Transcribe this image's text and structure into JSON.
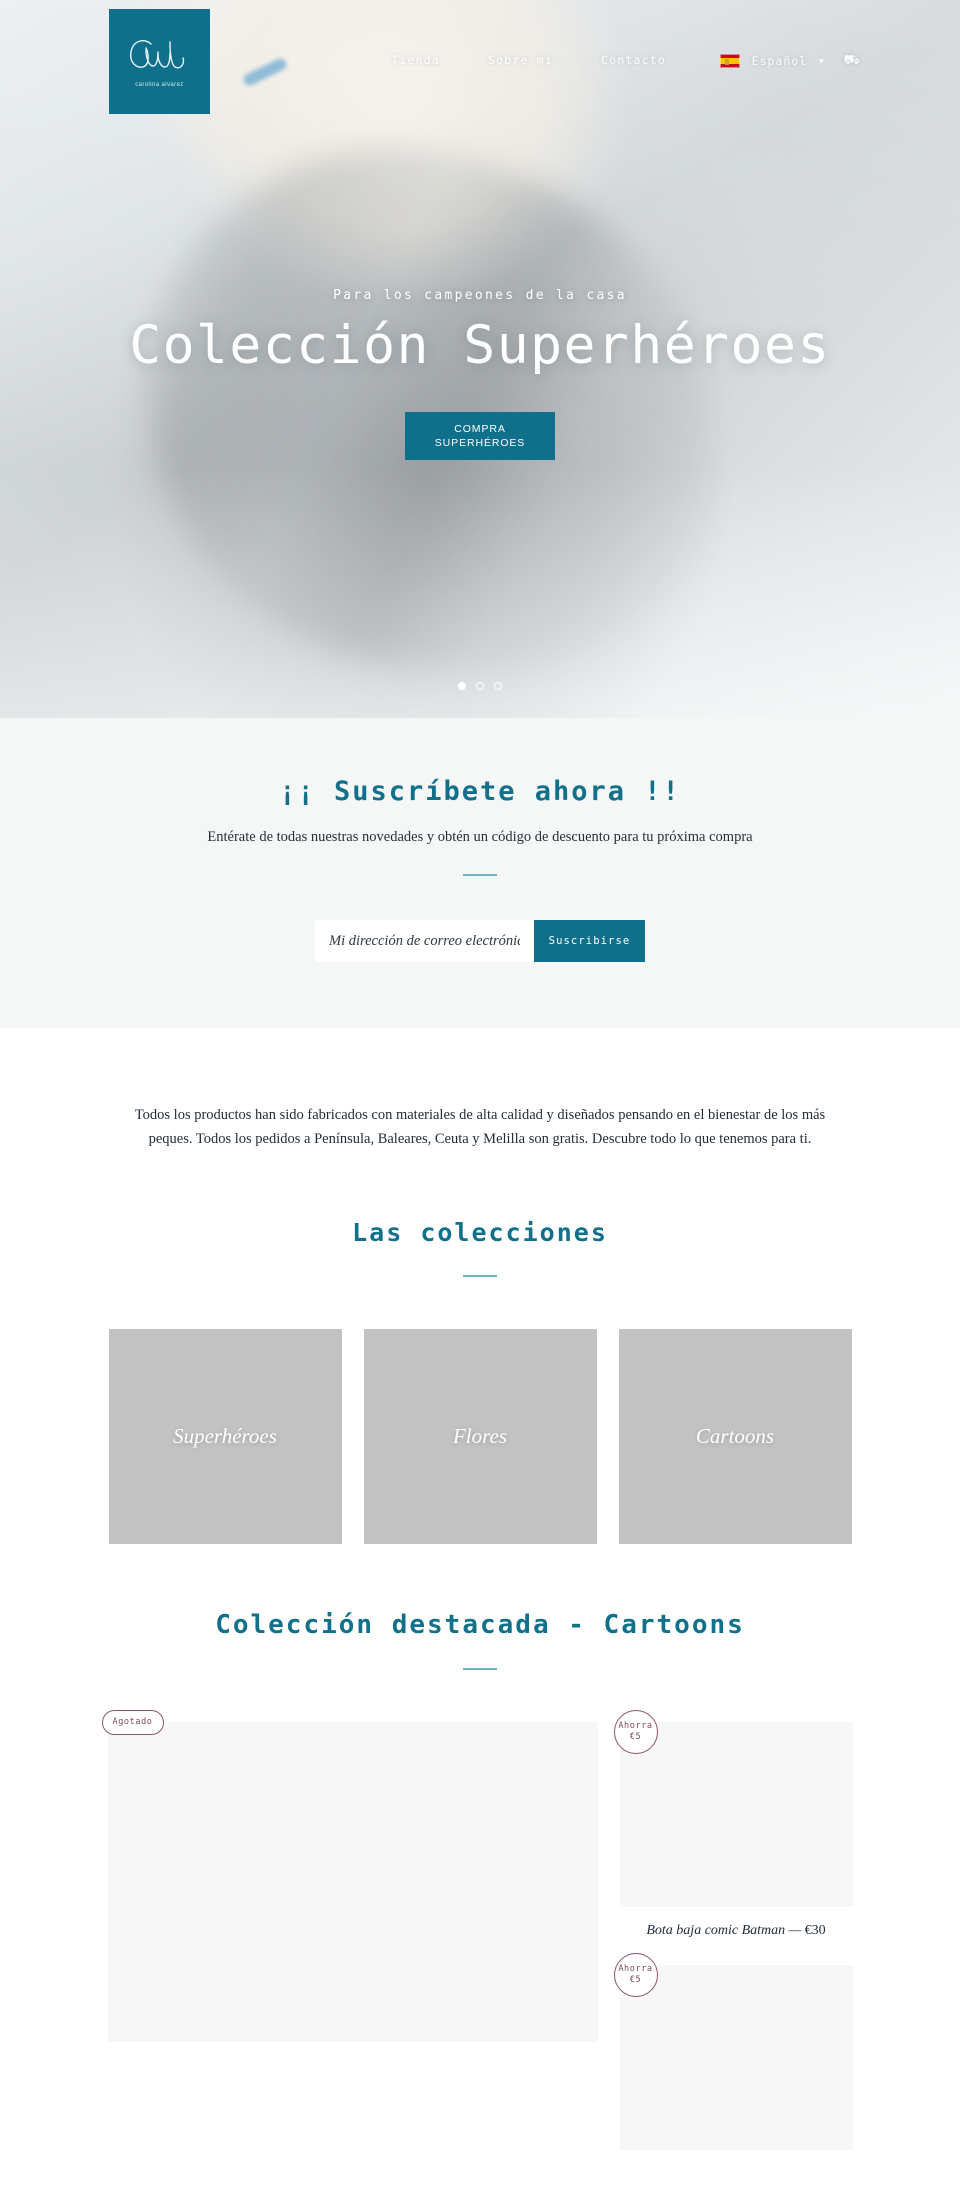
{
  "brand": {
    "logo_alt": "Cul",
    "logo_subtitle": "carolina alvarez"
  },
  "header": {
    "nav": [
      {
        "label": "Tienda"
      },
      {
        "label": "Sobre mí"
      },
      {
        "label": "Contacto"
      }
    ],
    "language": {
      "flag": "spain-flag-icon",
      "label": "Español",
      "chevron": "▾"
    },
    "cart": {
      "icon": "cart-icon",
      "glyph": "⛟"
    }
  },
  "hero": {
    "kicker": "Para los campeones de la casa",
    "title": "Colección Superhéroes",
    "cta_line1": "COMPRA",
    "cta_line2": "SUPERHÉROES",
    "slides": 3,
    "active_slide": 1
  },
  "newsletter": {
    "title": "¡¡ Suscríbete ahora !!",
    "subtitle": "Entérate de todas nuestras novedades y obtén un código de descuento para tu próxima compra",
    "email_placeholder": "Mi dirección de correo electrónico",
    "email_value": "",
    "submit_label": "Suscribirse"
  },
  "intro": {
    "text": "Todos los productos han sido fabricados con materiales de alta calidad y diseñados pensando en el bienestar de los más peques. Todos los pedidos a Península, Baleares, Ceuta y Melilla son gratis. Descubre todo lo que tenemos para ti."
  },
  "collections": {
    "title": "Las colecciones",
    "items": [
      {
        "name": "Superhéroes"
      },
      {
        "name": "Flores"
      },
      {
        "name": "Cartoons"
      }
    ]
  },
  "featured": {
    "title": "Colección destacada - Cartoons",
    "products": [
      {
        "badge_line1": "Agotado",
        "badge_line2": "",
        "badge_shape": "pill",
        "name": "",
        "price": ""
      },
      {
        "badge_line1": "Ahorra",
        "badge_line2": "€5",
        "badge_shape": "round",
        "name": "Bota baja comic Batman",
        "separator": "—",
        "price": "€30"
      },
      {
        "badge_line1": "Ahorra",
        "badge_line2": "€5",
        "badge_shape": "round",
        "name": "",
        "price": ""
      }
    ]
  },
  "colors": {
    "accent": "#10708c",
    "rule": "#6fb4c6",
    "badge": "#7b4a5c",
    "tile": "#c2c2c2"
  }
}
